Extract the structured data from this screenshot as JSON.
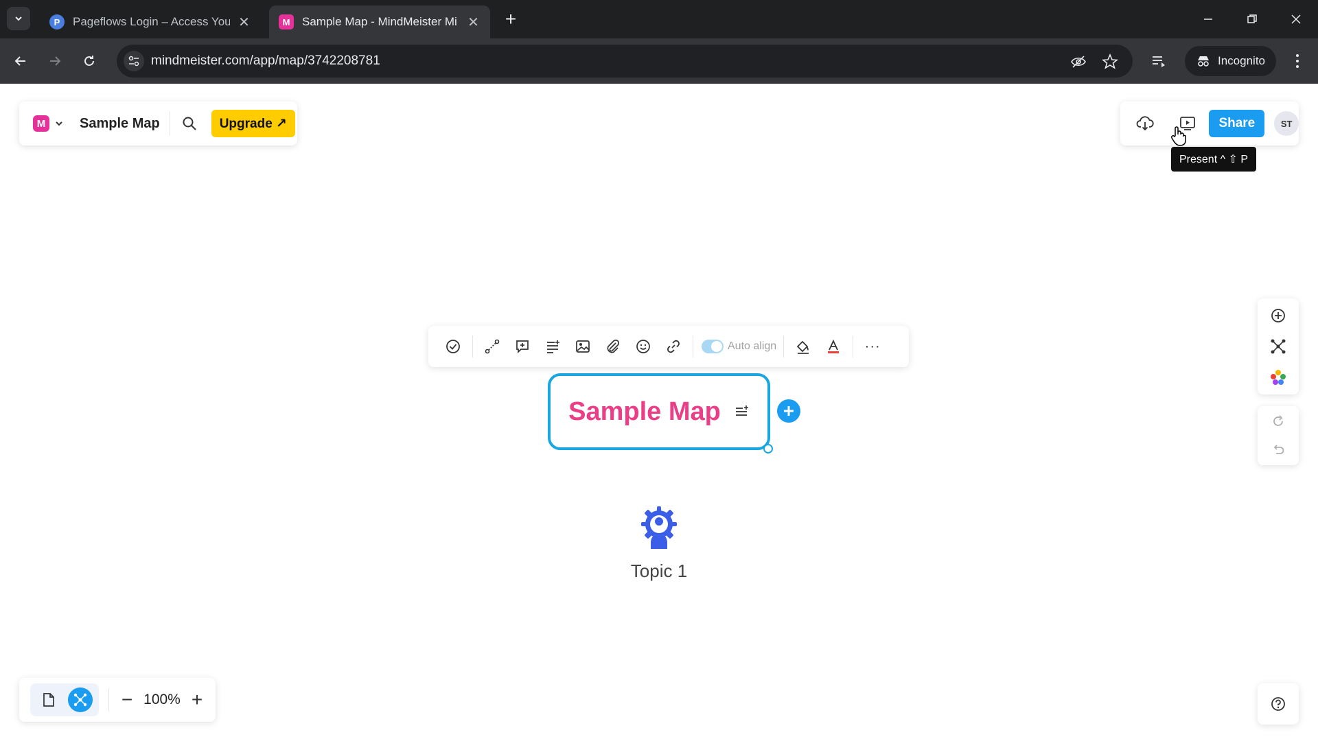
{
  "browser": {
    "tabs": [
      {
        "favicon": "P",
        "title": "Pageflows Login – Access Your",
        "favicon_color": "#4a7fe0"
      },
      {
        "favicon": "M",
        "title": "Sample Map - MindMeister Mi",
        "favicon_color": "#e7319a"
      }
    ],
    "url": "mindmeister.com/app/map/3742208781",
    "profile_label": "Incognito"
  },
  "app": {
    "logo_letter": "M",
    "map_name": "Sample Map",
    "upgrade_label": "Upgrade ↗",
    "share_label": "Share",
    "avatar_initials": "ST",
    "tooltip": "Present ^ ⇧ P",
    "toolbar": {
      "auto_align_label": "Auto align",
      "more_label": "···"
    },
    "root_node": {
      "label": "Sample Map"
    },
    "topic": {
      "label": "Topic 1",
      "icon": "gear-person-icon"
    },
    "zoom": {
      "value": "100%",
      "minus": "−",
      "plus": "+"
    },
    "colors": {
      "accent": "#1a9cf0",
      "node_text": "#ea3f86",
      "upgrade": "#ffcc00",
      "topic_icon": "#3b5ee8"
    }
  }
}
